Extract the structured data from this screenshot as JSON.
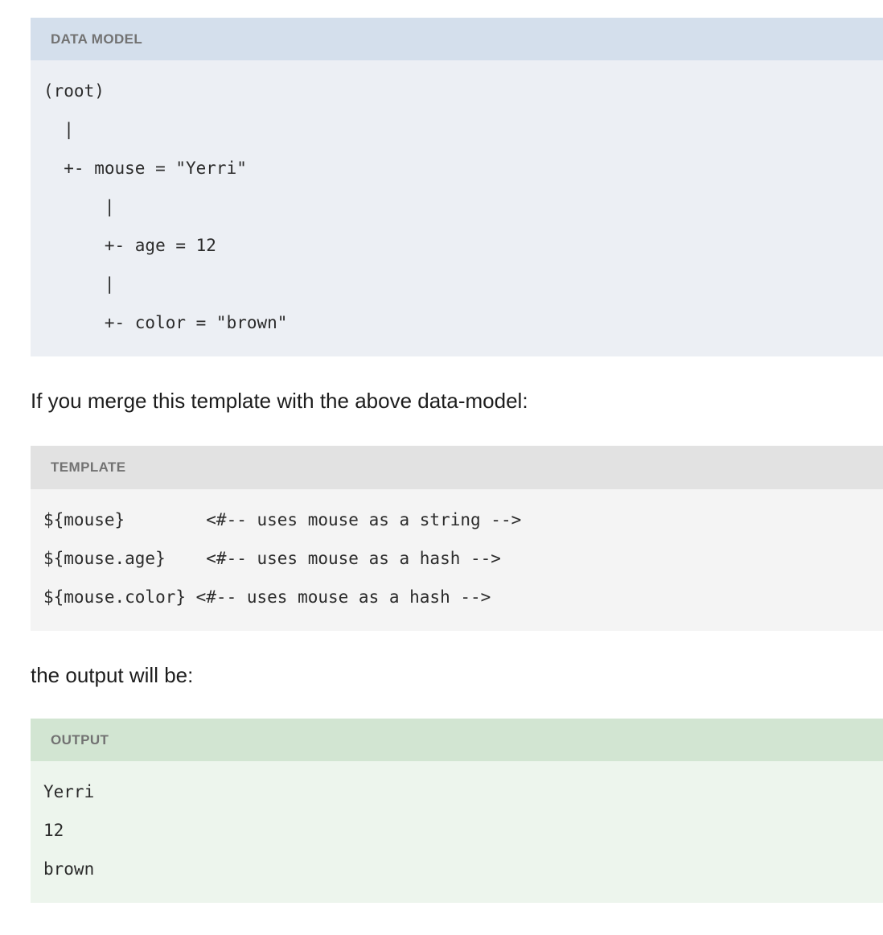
{
  "blocks": {
    "data_model": {
      "header": "DATA MODEL",
      "header_color": "#d4dfec",
      "body_color": "#eceff4",
      "lines": [
        "(root)",
        "  |",
        "  +- mouse = \"Yerri\"",
        "      |",
        "      +- age = 12",
        "      |",
        "      +- color = \"brown\""
      ]
    },
    "template": {
      "header": "TEMPLATE",
      "header_color": "#e2e2e2",
      "body_color": "#f4f4f4",
      "lines": [
        "${mouse}        <#-- uses mouse as a string -->",
        "${mouse.age}    <#-- uses mouse as a hash -->",
        "${mouse.color} <#-- uses mouse as a hash -->"
      ]
    },
    "output": {
      "header": "OUTPUT",
      "header_color": "#d2e5d2",
      "body_color": "#edf5ed",
      "lines": [
        "Yerri",
        "12",
        "brown"
      ]
    }
  },
  "paragraphs": {
    "merge_intro": "If you merge this template with the above data-model:",
    "output_intro": "the output will be:"
  }
}
